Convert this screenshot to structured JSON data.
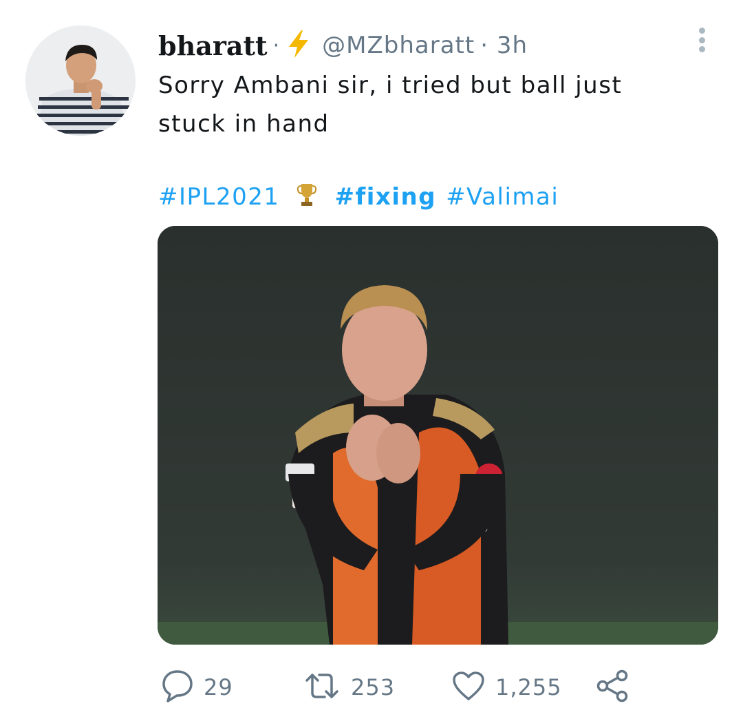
{
  "tweet": {
    "author_name": "bharatt",
    "separator": "·",
    "handle": "@MZbharatt",
    "time": "· 3h",
    "text_line1": "Sorry Ambani sir, i tried but ball just",
    "text_line2": "stuck in hand",
    "hashtags": {
      "ipl": "#IPL2021",
      "fixing": "#fixing",
      "valimai": "#Valimai"
    }
  },
  "icons": {
    "verified_badge": "lightning-bolt-icon",
    "hashtag_emoji": "trophy-icon",
    "more": "more-vertical-icon",
    "reply": "reply-icon",
    "retweet": "retweet-icon",
    "like": "heart-icon",
    "share": "share-icon"
  },
  "stats": {
    "replies": "29",
    "retweets": "253",
    "likes": "1,255"
  },
  "colors": {
    "accent": "#1da1f2",
    "secondary_text": "#657786",
    "bolt": "#f5b800"
  }
}
